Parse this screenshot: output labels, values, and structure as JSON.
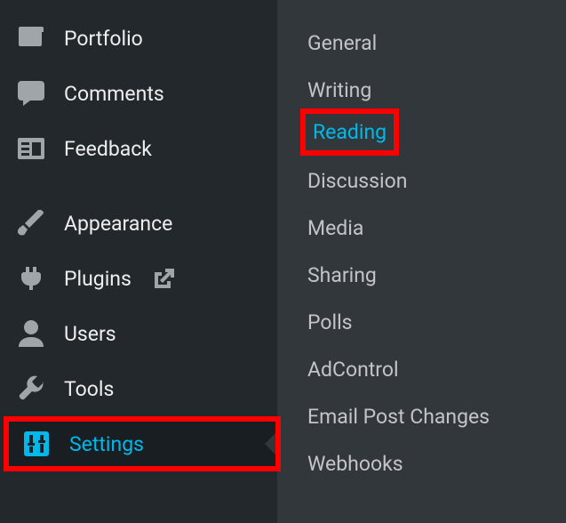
{
  "sidebar": {
    "items": [
      {
        "label": "Portfolio",
        "icon": "portfolio-icon",
        "active": false
      },
      {
        "label": "Comments",
        "icon": "comment-icon",
        "active": false
      },
      {
        "label": "Feedback",
        "icon": "feedback-icon",
        "active": false
      },
      {
        "label": "Appearance",
        "icon": "brush-icon",
        "active": false
      },
      {
        "label": "Plugins",
        "icon": "plugin-icon",
        "active": false,
        "external": true
      },
      {
        "label": "Users",
        "icon": "user-icon",
        "active": false
      },
      {
        "label": "Tools",
        "icon": "wrench-icon",
        "active": false
      },
      {
        "label": "Settings",
        "icon": "sliders-icon",
        "active": true,
        "highlighted": true
      }
    ]
  },
  "submenu": {
    "items": [
      {
        "label": "General",
        "active": false
      },
      {
        "label": "Writing",
        "active": false
      },
      {
        "label": "Reading",
        "active": true,
        "highlighted": true
      },
      {
        "label": "Discussion",
        "active": false
      },
      {
        "label": "Media",
        "active": false
      },
      {
        "label": "Sharing",
        "active": false
      },
      {
        "label": "Polls",
        "active": false
      },
      {
        "label": "AdControl",
        "active": false
      },
      {
        "label": "Email Post Changes",
        "active": false
      },
      {
        "label": "Webhooks",
        "active": false
      }
    ]
  }
}
